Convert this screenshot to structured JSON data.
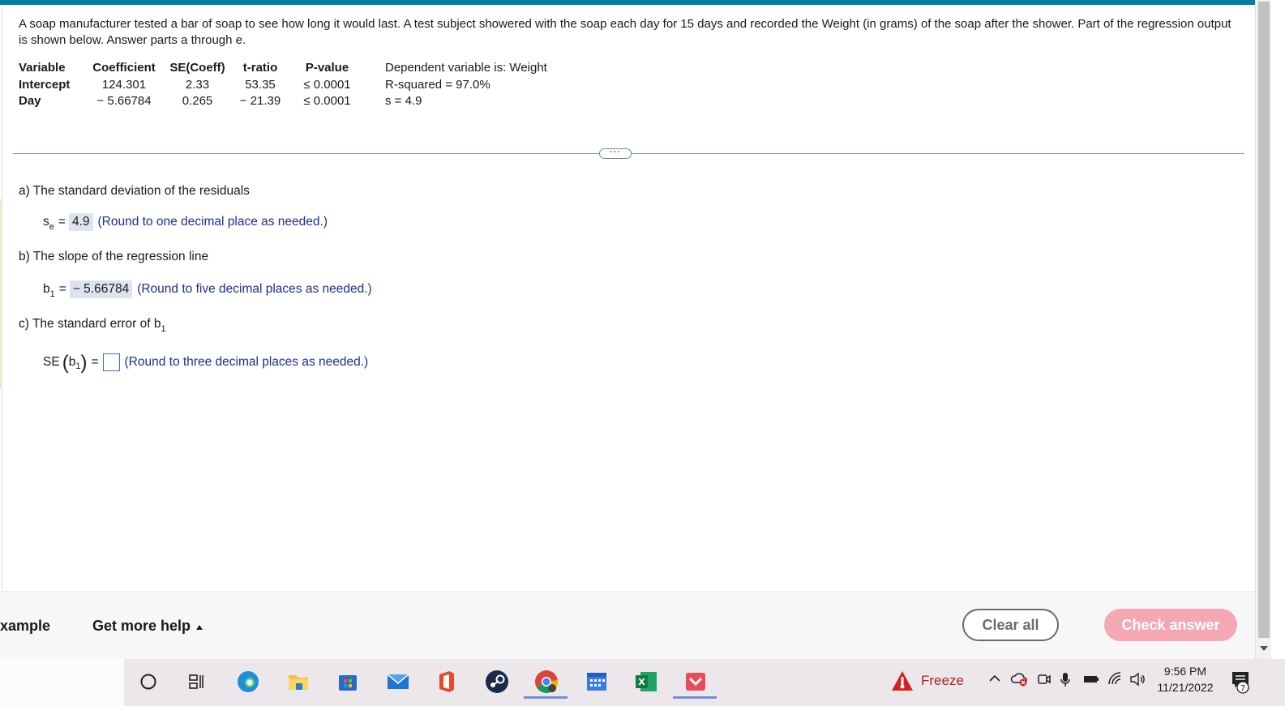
{
  "question": {
    "text": "A soap manufacturer tested a bar of soap to see how long it would last. A test subject showered with the soap each day for 15 days and recorded the Weight (in grams) of the soap after the shower. Part of the regression output is shown below. Answer parts a through e."
  },
  "regression": {
    "headers": [
      "Variable",
      "Coefficient",
      "SE(Coeff)",
      "t-ratio",
      "P-value"
    ],
    "rows": [
      [
        "Intercept",
        "124.301",
        "2.33",
        "53.35",
        "≤ 0.0001"
      ],
      [
        "Day",
        "− 5.66784",
        "0.265",
        "− 21.39",
        "≤ 0.0001"
      ]
    ],
    "dependent": "Dependent variable is: Weight",
    "r_squared": "R-squared = 97.0%",
    "s": "s = 4.9"
  },
  "divider": {
    "handle": "···"
  },
  "parts": {
    "a": {
      "label": "a) The standard deviation of the residuals",
      "symbol": "s",
      "sub": "e",
      "eq": "=",
      "value": "4.9",
      "hint": "(Round to one decimal place as needed.)"
    },
    "b": {
      "label": "b) The slope of the regression line",
      "symbol": "b",
      "sub": "1",
      "eq": "=",
      "value": "− 5.66784",
      "hint": "(Round to five decimal places as needed.)"
    },
    "c": {
      "label": "c) The standard error of b",
      "label_sub": "1",
      "symbol": "SE",
      "inner": "b",
      "inner_sub": "1",
      "eq": "=",
      "value": "",
      "hint": "(Round to three decimal places as needed.)"
    }
  },
  "footer": {
    "example": "example",
    "help": "Get more help",
    "clear": "Clear all",
    "check": "Check answer"
  },
  "taskbar": {
    "freeze": "Freeze",
    "time": "9:56 PM",
    "date": "11/21/2022",
    "notifications": "7"
  },
  "colors": {
    "topbar": "#007fa3",
    "hint": "#1c2f8f",
    "answer_bg": "#dde4ef",
    "check_button": "#f5a8b4",
    "clear_border": "#6b6b6b"
  }
}
